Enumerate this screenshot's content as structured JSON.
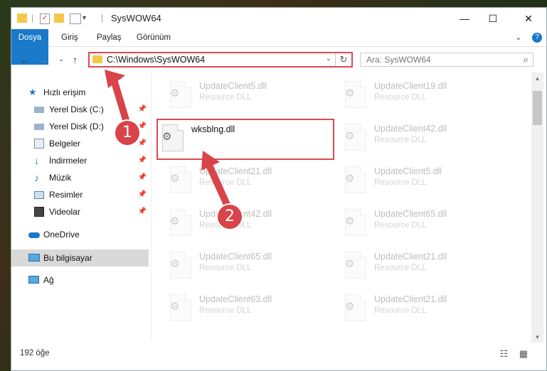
{
  "window": {
    "title": "SysWOW64",
    "minimize": "—",
    "maximize": "☐",
    "close": "✕"
  },
  "ribbon": {
    "tabs": [
      "Dosya",
      "Giriş",
      "Paylaş",
      "Görünüm"
    ],
    "expand": "⌄",
    "help": "?"
  },
  "address": {
    "path": "C:\\Windows\\SysWOW64",
    "dropdown": "⌄",
    "refresh": "↻"
  },
  "search": {
    "placeholder": "Ara: SysWOW64"
  },
  "nav": {
    "back": "←",
    "forward": "→",
    "recent": "⌄",
    "up": "↑",
    "items": [
      {
        "label": "Hızlı erişim",
        "icon": "star-icon"
      },
      {
        "label": "Yerel Disk (C:)",
        "icon": "drive-icon",
        "pinned": true
      },
      {
        "label": "Yerel Disk (D:)",
        "icon": "drive-icon",
        "pinned": true
      },
      {
        "label": "Belgeler",
        "icon": "documents-icon",
        "pinned": true
      },
      {
        "label": "İndirmeler",
        "icon": "downloads-icon",
        "pinned": true
      },
      {
        "label": "Müzik",
        "icon": "music-icon",
        "pinned": true
      },
      {
        "label": "Resimler",
        "icon": "pictures-icon",
        "pinned": true
      },
      {
        "label": "Videolar",
        "icon": "videos-icon",
        "pinned": true
      },
      {
        "label": "OneDrive",
        "icon": "cloud-icon"
      },
      {
        "label": "Bu bilgisayar",
        "icon": "computer-icon",
        "selected": true
      },
      {
        "label": "Ağ",
        "icon": "network-icon"
      }
    ]
  },
  "files": {
    "left": [
      {
        "name": "UpdateClient5.dll",
        "type": "Resource DLL"
      },
      {
        "name": "wksblng.dll",
        "type": ""
      },
      {
        "name": "UpdateClient21.dll",
        "type": "Resource DLL"
      },
      {
        "name": "UpdateClient42.dll",
        "type": "Resource DLL"
      },
      {
        "name": "UpdateClient65.dll",
        "type": "Resource DLL"
      },
      {
        "name": "UpdateClient63.dll",
        "type": "Resource DLL"
      }
    ],
    "right": [
      {
        "name": "UpdateClient19.dll",
        "type": "Resource DLL"
      },
      {
        "name": "UpdateClient42.dll",
        "type": "Resource DLL"
      },
      {
        "name": "UpdateClient5.dll",
        "type": "Resource DLL"
      },
      {
        "name": "UpdateClient65.dll",
        "type": "Resource DLL"
      },
      {
        "name": "UpdateClient21.dll",
        "type": "Resource DLL"
      },
      {
        "name": "UpdateClient21.dll",
        "type": "Resource DLL"
      }
    ]
  },
  "status": {
    "count": "192 öğe",
    "views": "☷ ▦"
  },
  "callouts": {
    "one": "1",
    "two": "2"
  },
  "colors": {
    "accent": "#1979ca",
    "highlight": "#d94b53"
  }
}
